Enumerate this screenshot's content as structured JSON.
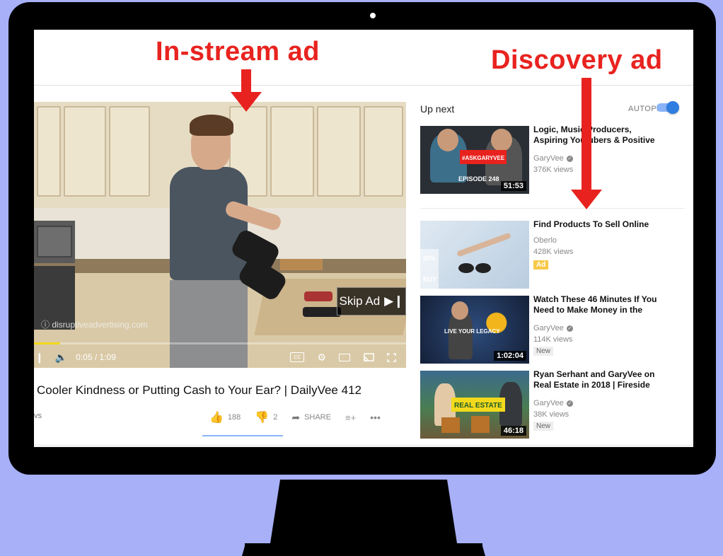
{
  "annotations": {
    "instream_label": "In-stream ad",
    "discovery_label": "Discovery ad"
  },
  "colors": {
    "background": "#a8b0f8",
    "annotation_red": "#e8231f",
    "ad_badge": "#f7c948",
    "toggle_blue": "#2f7de1"
  },
  "player": {
    "watermark": "disruptiveadvertising.com",
    "skip_label": "Skip Ad",
    "skip_icon": "skip-next-icon",
    "time": "0:05 / 1:09",
    "progress_fraction": 0.07,
    "cc_label": "CC"
  },
  "video": {
    "title": "Cooler Kindness or Putting Cash to Your Ear? | DailyVee 412",
    "views_fragment": "vs",
    "likes": "188",
    "dislikes": "2",
    "share_label": "SHARE"
  },
  "sidebar": {
    "up_next": "Up next",
    "autoplay": "AUTOPLAY",
    "autoplay_on": true,
    "items": [
      {
        "title_line1": "Logic, Music Producers,",
        "title_line2": "Aspiring Youtubers & Positive",
        "channel": "GaryVee",
        "views": "376K views",
        "duration": "51:53",
        "thumb_text": "#ASKGARYVEE",
        "thumb_text2": "EPISODE 248"
      },
      {
        "title_line1": "Find Products To Sell Online",
        "channel": "Oberlo",
        "views": "428K views",
        "badge": "Ad",
        "thumb_text": "20%",
        "thumb_text2": "BUY"
      },
      {
        "title_line1": "Watch These 46 Minutes If You",
        "title_line2": "Need to Make Money in the",
        "channel": "GaryVee",
        "views": "114K views",
        "badge": "New",
        "duration": "1:02:04",
        "thumb_text": "LIVE YOUR LEGACY"
      },
      {
        "title_line1": "Ryan Serhant and GaryVee on",
        "title_line2": "Real Estate in 2018 | Fireside",
        "channel": "GaryVee",
        "views": "38K views",
        "badge": "New",
        "duration": "46:18",
        "thumb_text": "REAL ESTATE"
      }
    ]
  }
}
